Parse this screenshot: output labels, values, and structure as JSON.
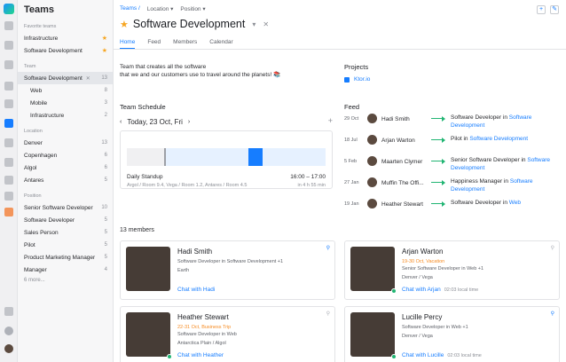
{
  "sidebar": {
    "title": "Teams",
    "favorite_label": "Favorite teams",
    "favorites": [
      {
        "label": "Infrastructure"
      },
      {
        "label": "Software Development"
      }
    ],
    "team_label": "Team",
    "team": {
      "label": "Software Development",
      "count": "13"
    },
    "subteams": [
      {
        "label": "Web",
        "count": "8"
      },
      {
        "label": "Mobile",
        "count": "3"
      },
      {
        "label": "Infrastructure",
        "count": "2"
      }
    ],
    "location_label": "Location",
    "locations": [
      {
        "label": "Denver",
        "count": "13"
      },
      {
        "label": "Copenhagen",
        "count": "6"
      },
      {
        "label": "Algol",
        "count": "6"
      },
      {
        "label": "Antares",
        "count": "5"
      }
    ],
    "position_label": "Position",
    "positions": [
      {
        "label": "Senior Software Developer",
        "count": "10"
      },
      {
        "label": "Software Developer",
        "count": "5"
      },
      {
        "label": "Sales Person",
        "count": "5"
      },
      {
        "label": "Pilot",
        "count": "5"
      },
      {
        "label": "Product Marketing Manager",
        "count": "5"
      },
      {
        "label": "Manager",
        "count": "4"
      }
    ],
    "more": "6 more..."
  },
  "header": {
    "crumbs": [
      "Teams /",
      "Location ▾",
      "Position ▾"
    ],
    "title": "Software Development",
    "tabs": [
      "Home",
      "Feed",
      "Members",
      "Calendar"
    ]
  },
  "description": [
    "Team that creates all the software",
    "that we and our customers use to travel around the planets! 📚"
  ],
  "schedule": {
    "heading": "Team Schedule",
    "date": "Today, 23 Oct, Fri",
    "event_title": "Daily Standup",
    "event_time": "16:00 – 17:00",
    "event_location": "Argol / Room 9.4, Vega / Room 1.2, Antares / Room 4.5",
    "event_in": "in 4 h 55 min",
    "progress": 0.62
  },
  "projects": {
    "heading": "Projects",
    "item": "Ktor.io"
  },
  "feed": {
    "heading": "Feed",
    "items": [
      {
        "date": "29 Oct",
        "name": "Hadi Smith",
        "role": "Software Developer in ",
        "team": "Software Development"
      },
      {
        "date": "18 Jul",
        "name": "Arjan Warton",
        "role": "Pilot in ",
        "team": "Software Development"
      },
      {
        "date": "5 Feb",
        "name": "Maarten Clymer",
        "role": "Senior Software Developer in ",
        "team": "Software Development"
      },
      {
        "date": "27 Jan",
        "name": "Muffin The Offi...",
        "role": "Happiness Manager in ",
        "team": "Software Development"
      },
      {
        "date": "19 Jan",
        "name": "Heather Stewart",
        "role": "Software Developer in ",
        "team": "Web"
      }
    ]
  },
  "members": {
    "heading": "13 members",
    "items": [
      {
        "name": "Hadi Smith",
        "l1": "Software Developer in Software Development  +1",
        "l2": "Earth",
        "chat": "Chat with Hadi",
        "local": ""
      },
      {
        "name": "Arjan Warton",
        "l1": "19-30 Oct, Vacation",
        "l1b": "Senior Software Developer in Web  +1",
        "l2": "Denver / Vega",
        "chat": "Chat with Arjan",
        "local": "02:03 local time"
      },
      {
        "name": "Heather Stewart",
        "l1": "22-31 Oct, Business Trip",
        "l1b": "Software Developer in Web",
        "l2": "Antarctica Plain / Algol",
        "chat": "Chat with Heather",
        "local": ""
      },
      {
        "name": "Lucille Percy",
        "l1": "Software Developer in Web  +1",
        "l2": "Denver / Vega",
        "chat": "Chat with Lucille",
        "local": "02:03 local time"
      }
    ]
  }
}
